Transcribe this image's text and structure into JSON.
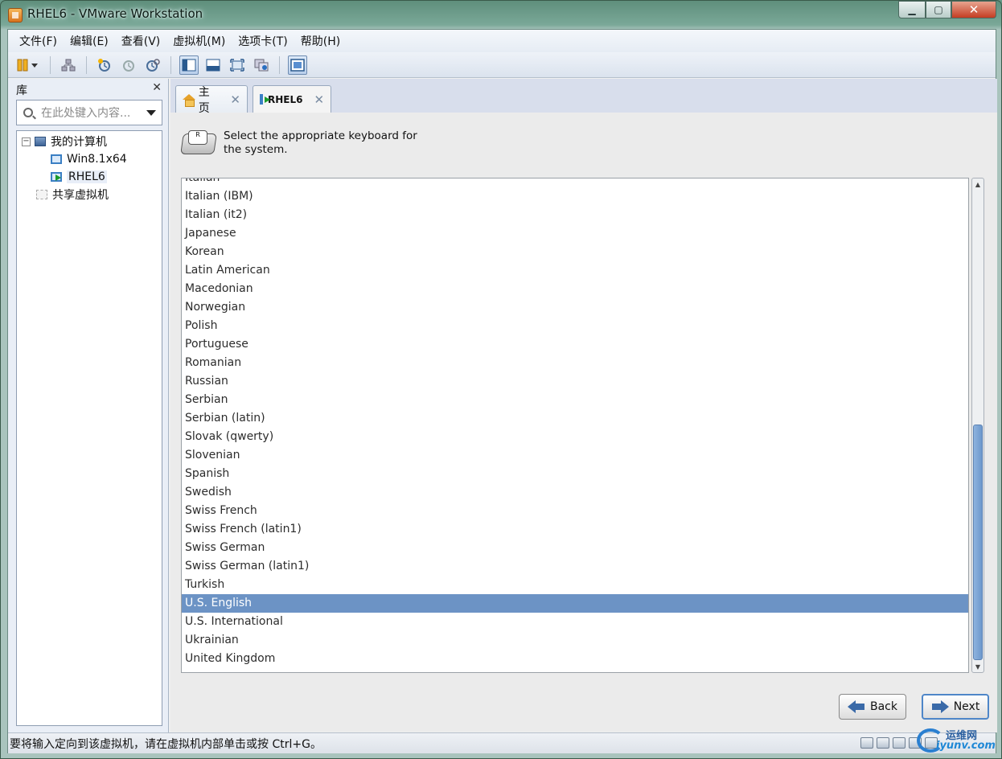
{
  "window": {
    "title": "RHEL6 - VMware Workstation"
  },
  "menubar": {
    "items": [
      "文件(F)",
      "编辑(E)",
      "查看(V)",
      "虚拟机(M)",
      "选项卡(T)",
      "帮助(H)"
    ]
  },
  "toolbar": {
    "buttons": [
      "pause-icon",
      "network-icon",
      "snapshot-take-icon",
      "snapshot-revert-icon",
      "snapshot-manager-icon",
      "view-console-icon",
      "view-tabs-icon",
      "fullscreen-icon",
      "unity-icon",
      "quickswitch-icon"
    ]
  },
  "library": {
    "title": "库",
    "search_placeholder": "在此处键入内容...",
    "tree": [
      {
        "label": "我的计算机",
        "expander": "⊟"
      },
      {
        "label": "Win8.1x64"
      },
      {
        "label": "RHEL6"
      },
      {
        "label": "共享虚拟机"
      }
    ]
  },
  "tabs": [
    {
      "label": "主页"
    },
    {
      "label": "RHEL6"
    }
  ],
  "guest": {
    "instruction": "Select the appropriate keyboard for the system.",
    "keyboards": [
      "Italian",
      "Italian (IBM)",
      "Italian (it2)",
      "Japanese",
      "Korean",
      "Latin American",
      "Macedonian",
      "Norwegian",
      "Polish",
      "Portuguese",
      "Romanian",
      "Russian",
      "Serbian",
      "Serbian (latin)",
      "Slovak (qwerty)",
      "Slovenian",
      "Spanish",
      "Swedish",
      "Swiss French",
      "Swiss French (latin1)",
      "Swiss German",
      "Swiss German (latin1)",
      "Turkish",
      "U.S. English",
      "U.S. International",
      "Ukrainian",
      "United Kingdom"
    ],
    "selected": "U.S. English",
    "back_label": "Back",
    "next_label": "Next"
  },
  "status": {
    "text": "要将输入定向到该虚拟机，请在虚拟机内部单击或按 Ctrl+G。"
  },
  "watermark": {
    "line1": "运维网",
    "line2": "iyunv.com"
  },
  "colors": {
    "selection": "#6c93c5",
    "tabstrip": "#d8deec",
    "titlebar": "#7aa898"
  }
}
